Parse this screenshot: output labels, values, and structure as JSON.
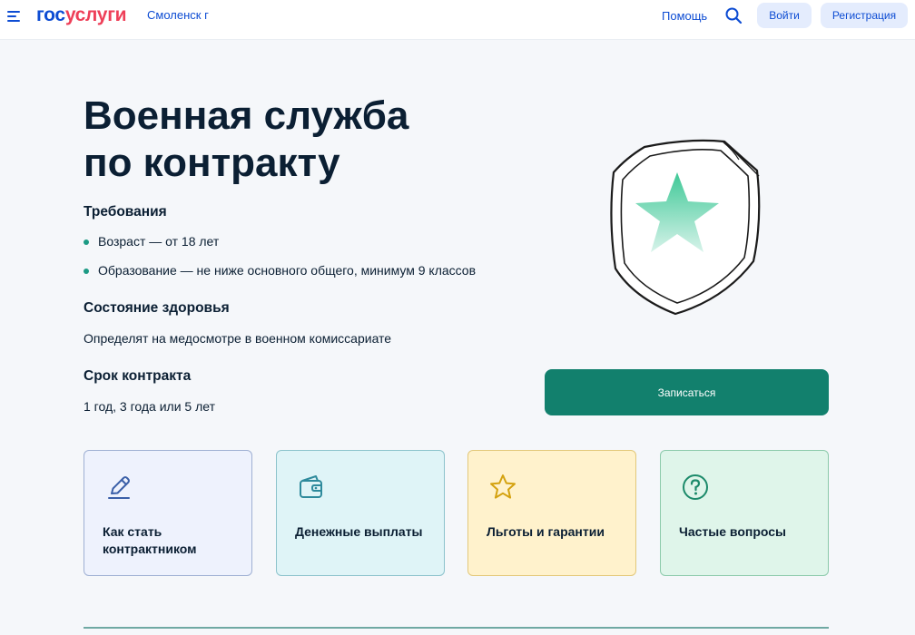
{
  "header": {
    "logo_part1": "гос",
    "logo_part2": "услуги",
    "city": "Смоленск г",
    "help_label": "Помощь",
    "login_label": "Войти",
    "register_label": "Регистрация",
    "brand_blue": "#0d4cd3",
    "brand_red": "#ee3f58"
  },
  "main": {
    "title_line1": "Военная служба",
    "title_line2": "по контракту",
    "requirements": {
      "heading": "Требования",
      "items": [
        "Возраст — от 18 лет",
        "Образование — не ниже основного общего, минимум 9 классов"
      ]
    },
    "health": {
      "heading": "Состояние здоровья",
      "text": "Определят на медосмотре в военном комиссариате"
    },
    "term": {
      "heading": "Срок контракта",
      "text": "1 год, 3 года или 5 лет"
    },
    "cta_label": "Записаться",
    "accent": "#12806d"
  },
  "cards": [
    {
      "label": "Как стать контрактником",
      "icon": "pencil-icon"
    },
    {
      "label": "Денежные выплаты",
      "icon": "wallet-icon"
    },
    {
      "label": "Льготы и гарантии",
      "icon": "star-icon"
    },
    {
      "label": "Частые вопросы",
      "icon": "question-icon"
    }
  ]
}
